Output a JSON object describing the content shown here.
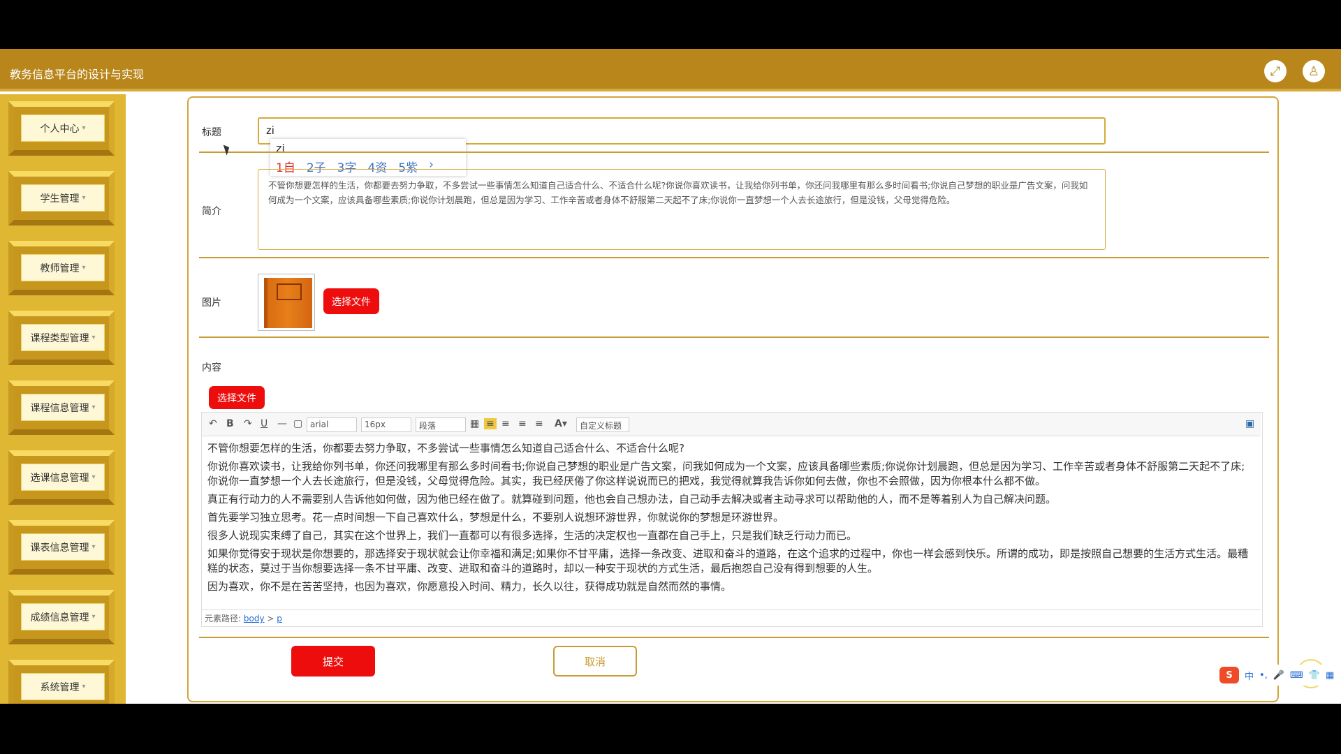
{
  "app": {
    "title": "教务信息平台的设计与实现"
  },
  "header": {
    "icons": [
      "fullscreen-icon",
      "user-icon"
    ]
  },
  "sidebar": {
    "items": [
      {
        "label": "个人中心"
      },
      {
        "label": "学生管理"
      },
      {
        "label": "教师管理"
      },
      {
        "label": "课程类型管理"
      },
      {
        "label": "课程信息管理"
      },
      {
        "label": "选课信息管理"
      },
      {
        "label": "课表信息管理"
      },
      {
        "label": "成绩信息管理"
      },
      {
        "label": "系统管理"
      }
    ]
  },
  "form": {
    "title_label": "标题",
    "title_value": "zi",
    "intro_label": "简介",
    "intro_value": "不管你想要怎样的生活，你都要去努力争取，不多尝试一些事情怎么知道自己适合什么、不适合什么呢?你说你喜欢读书，让我给你列书单，你还问我哪里有那么多时间看书;你说自己梦想的职业是广告文案，问我如何成为一个文案，应该具备哪些素质;你说你计划晨跑，但总是因为学习、工作辛苦或者身体不舒服第二天起不了床;你说你一直梦想一个人去长途旅行，但是没钱，父母觉得危险。",
    "image_label": "图片",
    "choose_file": "选择文件",
    "content_label": "内容",
    "submit": "提交",
    "cancel": "取消"
  },
  "ime": {
    "pinyin": "zi",
    "candidates": [
      "1自",
      "2子",
      "3字",
      "4资",
      "5紫"
    ]
  },
  "editor": {
    "font_family": "arial",
    "font_size": "16px",
    "paragraph": "段落",
    "custom_title": "自定义标题",
    "paragraphs": [
      "不管你想要怎样的生活，你都要去努力争取，不多尝试一些事情怎么知道自己适合什么、不适合什么呢?",
      "你说你喜欢读书，让我给你列书单，你还问我哪里有那么多时间看书;你说自己梦想的职业是广告文案，问我如何成为一个文案，应该具备哪些素质;你说你计划晨跑，但总是因为学习、工作辛苦或者身体不舒服第二天起不了床;你说你一直梦想一个人去长途旅行，但是没钱，父母觉得危险。其实，我已经厌倦了你这样说说而已的把戏，我觉得就算我告诉你如何去做，你也不会照做，因为你根本什么都不做。",
      "真正有行动力的人不需要别人告诉他如何做，因为他已经在做了。就算碰到问题，他也会自己想办法，自己动手去解决或者主动寻求可以帮助他的人，而不是等着别人为自己解决问题。",
      "首先要学习独立思考。花一点时间想一下自己喜欢什么，梦想是什么，不要别人说想环游世界，你就说你的梦想是环游世界。",
      "很多人说现实束缚了自己，其实在这个世界上，我们一直都可以有很多选择，生活的决定权也一直都在自己手上，只是我们缺乏行动力而已。",
      "如果你觉得安于现状是你想要的，那选择安于现状就会让你幸福和满足;如果你不甘平庸，选择一条改变、进取和奋斗的道路，在这个追求的过程中，你也一样会感到快乐。所谓的成功，即是按照自己想要的生活方式生活。最糟糕的状态，莫过于当你想要选择一条不甘平庸、改变、进取和奋斗的道路时，却以一种安于现状的方式生活，最后抱怨自己没有得到想要的人生。",
      "因为喜欢，你不是在苦苦坚持，也因为喜欢，你愿意投入时间、精力，长久以往，获得成功就是自然而然的事情。"
    ],
    "path_label": "元素路径:",
    "path_body": "body",
    "path_separator": ">",
    "path_p": "p"
  },
  "taskbar": {
    "ime_logo": "S",
    "ime_mode": "中",
    "ime_punct": "•,"
  }
}
